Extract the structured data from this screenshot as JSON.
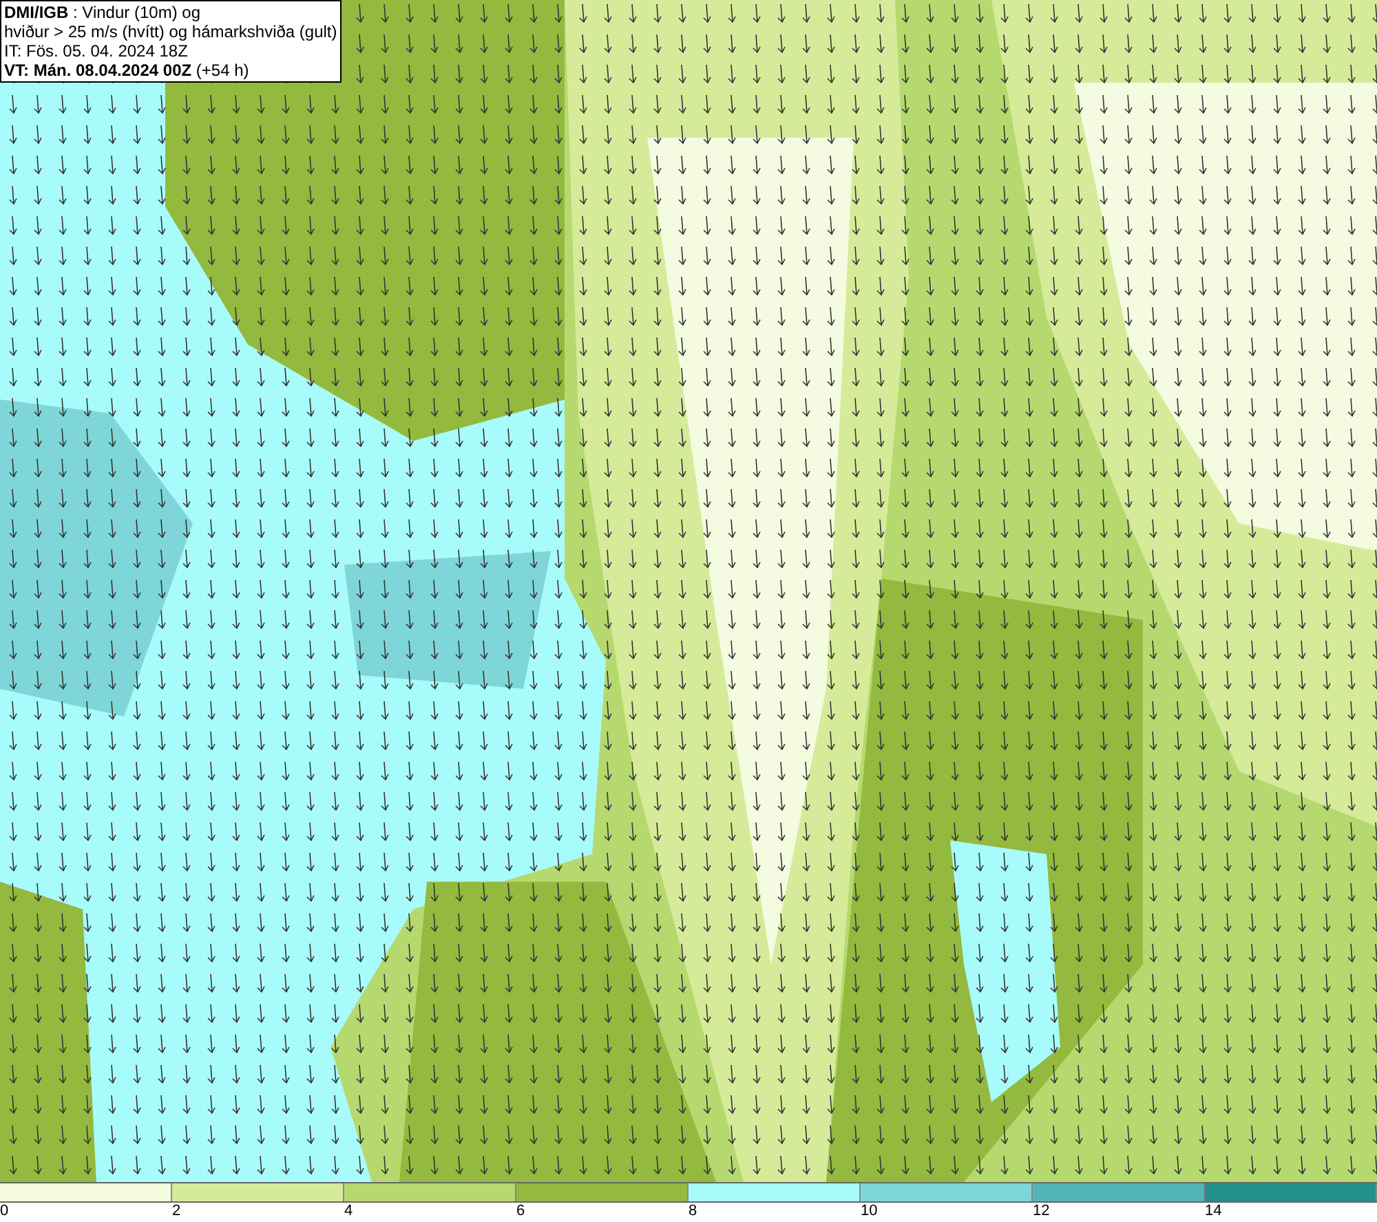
{
  "title_box": {
    "lines": [
      "**DMI/IGB** : Vindur (10m) og",
      "hviður > 25 m/s (hvítt) og hámarkshviða (gult)",
      "IT: Fös. 05. 04. 2024 18Z",
      "**VT: Mán. 08.04.2024 00Z** (+54 h)"
    ]
  },
  "legend": [
    {
      "label": "0",
      "color": "#f5fbe0"
    },
    {
      "label": "2",
      "color": "#d6eb9a"
    },
    {
      "label": "4",
      "color": "#b6d96f"
    },
    {
      "label": "6",
      "color": "#93b93f"
    },
    {
      "label": "8",
      "color": "#a8fbfb"
    },
    {
      "label": "10",
      "color": "#7fd6d8"
    },
    {
      "label": "12",
      "color": "#53b4b6"
    },
    {
      "label": "14",
      "color": "#23908c"
    }
  ]
}
